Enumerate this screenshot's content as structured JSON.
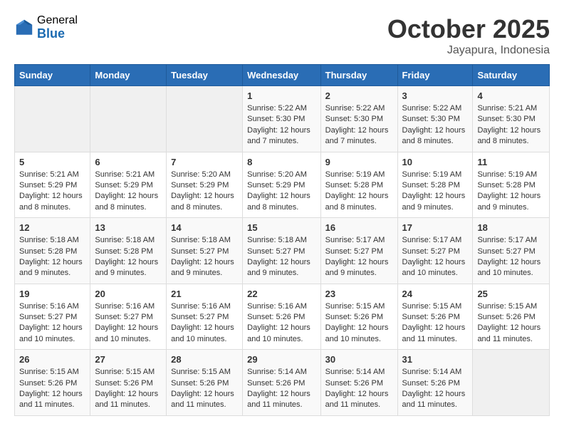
{
  "logo": {
    "general": "General",
    "blue": "Blue"
  },
  "header": {
    "month": "October 2025",
    "location": "Jayapura, Indonesia"
  },
  "weekdays": [
    "Sunday",
    "Monday",
    "Tuesday",
    "Wednesday",
    "Thursday",
    "Friday",
    "Saturday"
  ],
  "weeks": [
    [
      {
        "day": "",
        "sunrise": "",
        "sunset": "",
        "daylight": ""
      },
      {
        "day": "",
        "sunrise": "",
        "sunset": "",
        "daylight": ""
      },
      {
        "day": "",
        "sunrise": "",
        "sunset": "",
        "daylight": ""
      },
      {
        "day": "1",
        "sunrise": "Sunrise: 5:22 AM",
        "sunset": "Sunset: 5:30 PM",
        "daylight": "Daylight: 12 hours and 7 minutes."
      },
      {
        "day": "2",
        "sunrise": "Sunrise: 5:22 AM",
        "sunset": "Sunset: 5:30 PM",
        "daylight": "Daylight: 12 hours and 7 minutes."
      },
      {
        "day": "3",
        "sunrise": "Sunrise: 5:22 AM",
        "sunset": "Sunset: 5:30 PM",
        "daylight": "Daylight: 12 hours and 8 minutes."
      },
      {
        "day": "4",
        "sunrise": "Sunrise: 5:21 AM",
        "sunset": "Sunset: 5:30 PM",
        "daylight": "Daylight: 12 hours and 8 minutes."
      }
    ],
    [
      {
        "day": "5",
        "sunrise": "Sunrise: 5:21 AM",
        "sunset": "Sunset: 5:29 PM",
        "daylight": "Daylight: 12 hours and 8 minutes."
      },
      {
        "day": "6",
        "sunrise": "Sunrise: 5:21 AM",
        "sunset": "Sunset: 5:29 PM",
        "daylight": "Daylight: 12 hours and 8 minutes."
      },
      {
        "day": "7",
        "sunrise": "Sunrise: 5:20 AM",
        "sunset": "Sunset: 5:29 PM",
        "daylight": "Daylight: 12 hours and 8 minutes."
      },
      {
        "day": "8",
        "sunrise": "Sunrise: 5:20 AM",
        "sunset": "Sunset: 5:29 PM",
        "daylight": "Daylight: 12 hours and 8 minutes."
      },
      {
        "day": "9",
        "sunrise": "Sunrise: 5:19 AM",
        "sunset": "Sunset: 5:28 PM",
        "daylight": "Daylight: 12 hours and 8 minutes."
      },
      {
        "day": "10",
        "sunrise": "Sunrise: 5:19 AM",
        "sunset": "Sunset: 5:28 PM",
        "daylight": "Daylight: 12 hours and 9 minutes."
      },
      {
        "day": "11",
        "sunrise": "Sunrise: 5:19 AM",
        "sunset": "Sunset: 5:28 PM",
        "daylight": "Daylight: 12 hours and 9 minutes."
      }
    ],
    [
      {
        "day": "12",
        "sunrise": "Sunrise: 5:18 AM",
        "sunset": "Sunset: 5:28 PM",
        "daylight": "Daylight: 12 hours and 9 minutes."
      },
      {
        "day": "13",
        "sunrise": "Sunrise: 5:18 AM",
        "sunset": "Sunset: 5:28 PM",
        "daylight": "Daylight: 12 hours and 9 minutes."
      },
      {
        "day": "14",
        "sunrise": "Sunrise: 5:18 AM",
        "sunset": "Sunset: 5:27 PM",
        "daylight": "Daylight: 12 hours and 9 minutes."
      },
      {
        "day": "15",
        "sunrise": "Sunrise: 5:18 AM",
        "sunset": "Sunset: 5:27 PM",
        "daylight": "Daylight: 12 hours and 9 minutes."
      },
      {
        "day": "16",
        "sunrise": "Sunrise: 5:17 AM",
        "sunset": "Sunset: 5:27 PM",
        "daylight": "Daylight: 12 hours and 9 minutes."
      },
      {
        "day": "17",
        "sunrise": "Sunrise: 5:17 AM",
        "sunset": "Sunset: 5:27 PM",
        "daylight": "Daylight: 12 hours and 10 minutes."
      },
      {
        "day": "18",
        "sunrise": "Sunrise: 5:17 AM",
        "sunset": "Sunset: 5:27 PM",
        "daylight": "Daylight: 12 hours and 10 minutes."
      }
    ],
    [
      {
        "day": "19",
        "sunrise": "Sunrise: 5:16 AM",
        "sunset": "Sunset: 5:27 PM",
        "daylight": "Daylight: 12 hours and 10 minutes."
      },
      {
        "day": "20",
        "sunrise": "Sunrise: 5:16 AM",
        "sunset": "Sunset: 5:27 PM",
        "daylight": "Daylight: 12 hours and 10 minutes."
      },
      {
        "day": "21",
        "sunrise": "Sunrise: 5:16 AM",
        "sunset": "Sunset: 5:27 PM",
        "daylight": "Daylight: 12 hours and 10 minutes."
      },
      {
        "day": "22",
        "sunrise": "Sunrise: 5:16 AM",
        "sunset": "Sunset: 5:26 PM",
        "daylight": "Daylight: 12 hours and 10 minutes."
      },
      {
        "day": "23",
        "sunrise": "Sunrise: 5:15 AM",
        "sunset": "Sunset: 5:26 PM",
        "daylight": "Daylight: 12 hours and 10 minutes."
      },
      {
        "day": "24",
        "sunrise": "Sunrise: 5:15 AM",
        "sunset": "Sunset: 5:26 PM",
        "daylight": "Daylight: 12 hours and 11 minutes."
      },
      {
        "day": "25",
        "sunrise": "Sunrise: 5:15 AM",
        "sunset": "Sunset: 5:26 PM",
        "daylight": "Daylight: 12 hours and 11 minutes."
      }
    ],
    [
      {
        "day": "26",
        "sunrise": "Sunrise: 5:15 AM",
        "sunset": "Sunset: 5:26 PM",
        "daylight": "Daylight: 12 hours and 11 minutes."
      },
      {
        "day": "27",
        "sunrise": "Sunrise: 5:15 AM",
        "sunset": "Sunset: 5:26 PM",
        "daylight": "Daylight: 12 hours and 11 minutes."
      },
      {
        "day": "28",
        "sunrise": "Sunrise: 5:15 AM",
        "sunset": "Sunset: 5:26 PM",
        "daylight": "Daylight: 12 hours and 11 minutes."
      },
      {
        "day": "29",
        "sunrise": "Sunrise: 5:14 AM",
        "sunset": "Sunset: 5:26 PM",
        "daylight": "Daylight: 12 hours and 11 minutes."
      },
      {
        "day": "30",
        "sunrise": "Sunrise: 5:14 AM",
        "sunset": "Sunset: 5:26 PM",
        "daylight": "Daylight: 12 hours and 11 minutes."
      },
      {
        "day": "31",
        "sunrise": "Sunrise: 5:14 AM",
        "sunset": "Sunset: 5:26 PM",
        "daylight": "Daylight: 12 hours and 11 minutes."
      },
      {
        "day": "",
        "sunrise": "",
        "sunset": "",
        "daylight": ""
      }
    ]
  ]
}
